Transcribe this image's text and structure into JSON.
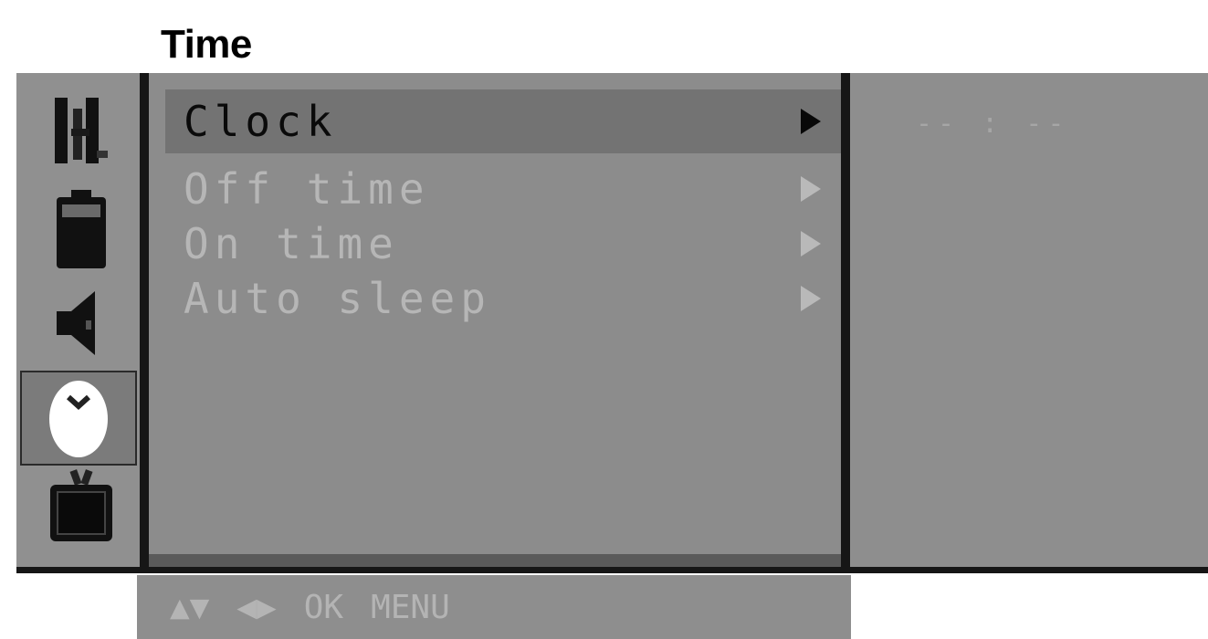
{
  "title": "Time",
  "sidebar": {
    "icons": [
      {
        "name": "picture-icon",
        "active": false
      },
      {
        "name": "battery-icon",
        "active": false
      },
      {
        "name": "speaker-icon",
        "active": false
      },
      {
        "name": "clock-icon",
        "active": true
      },
      {
        "name": "tv-icon",
        "active": false
      }
    ]
  },
  "menu": {
    "items": [
      {
        "label": "Clock",
        "selected": true
      },
      {
        "label": "Off time",
        "selected": false
      },
      {
        "label": "On time",
        "selected": false
      },
      {
        "label": "Auto sleep",
        "selected": false
      }
    ]
  },
  "clock_value": "-- : --",
  "help_bar": {
    "updown": "▲▼",
    "leftright": "◀▶",
    "ok": "OK",
    "menu": "MENU"
  },
  "colors": {
    "osd_bg": "#8f8f8f",
    "selected_bg": "#737373",
    "divider": "#161616",
    "dim_text": "#b6b6b6"
  }
}
